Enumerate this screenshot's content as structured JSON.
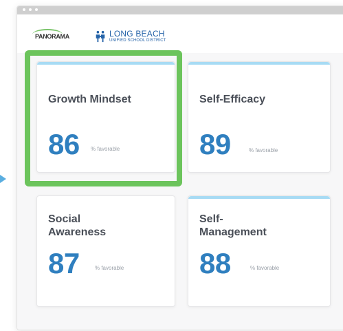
{
  "header": {
    "panorama_logo": "PANORAMA",
    "district_name": "LONG BEACH",
    "district_sub": "UNIFIED SCHOOL DISTRICT"
  },
  "cards": [
    {
      "title": "Growth Mindset",
      "score": "86",
      "unit": "% favorable"
    },
    {
      "title": "Self-Efficacy",
      "score": "89",
      "unit": "% favorable"
    },
    {
      "title": "Social Awareness",
      "score": "87",
      "unit": "% favorable"
    },
    {
      "title": "Self-Management",
      "score": "88",
      "unit": "% favorable"
    }
  ],
  "colors": {
    "accent_highlight": "#6cc45c",
    "score_blue": "#2f7fbf",
    "card_topbar": "#a7dbf4",
    "district_blue": "#2563a8"
  },
  "icons": {
    "pointer": "right-triangle-arrow-icon",
    "district": "family-figures-icon"
  }
}
